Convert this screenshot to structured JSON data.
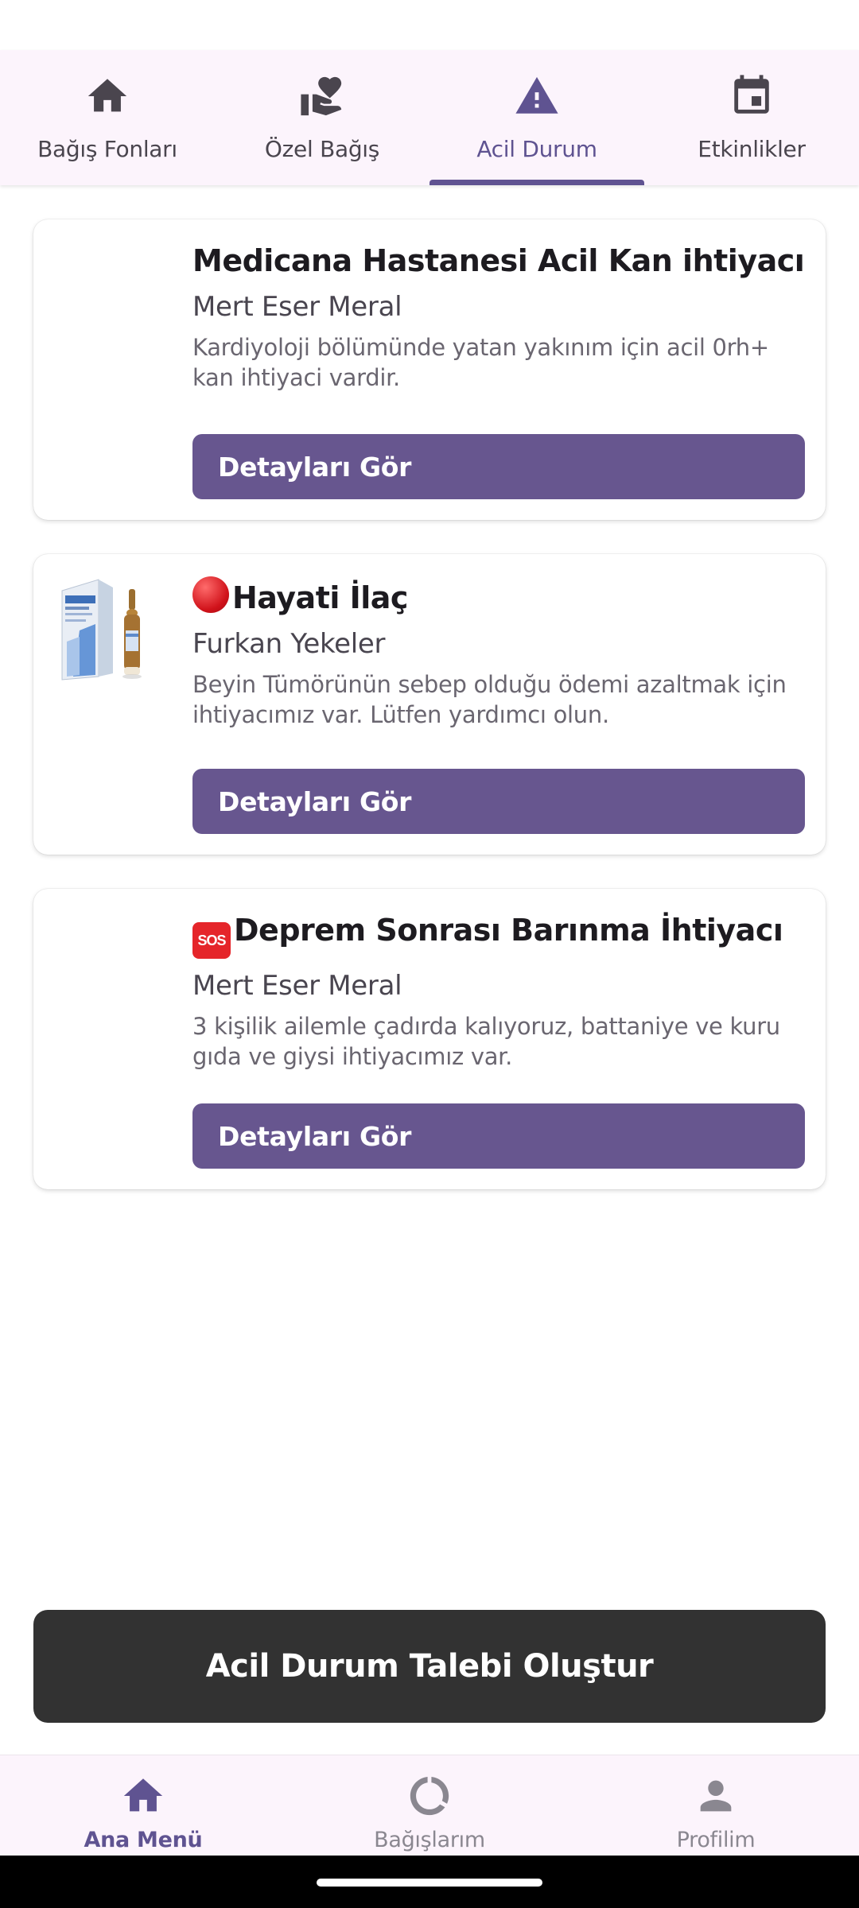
{
  "top_tabs": [
    {
      "label": "Bağış Fonları",
      "icon": "home-icon",
      "active": false
    },
    {
      "label": "Özel Bağış",
      "icon": "volunteer-heart-hand-icon",
      "active": false
    },
    {
      "label": "Acil Durum",
      "icon": "warning-icon",
      "active": true
    },
    {
      "label": "Etkinlikler",
      "icon": "calendar-icon",
      "active": false
    }
  ],
  "cards": [
    {
      "title": "Medicana Hastanesi Acil Kan ihtiyacı",
      "title_emoji": "",
      "author": "Mert Eser Meral",
      "description": "Kardiyoloji bölümünde yatan yakınım için acil 0rh+ kan ihtiyaci vardir.",
      "button_label": "Detayları Gör",
      "has_image": false
    },
    {
      "title": "Hayati İlaç",
      "title_emoji": "red-circle",
      "author": "Furkan Yekeler",
      "description": "Beyin Tümörünün sebep olduğu ödemi azaltmak için ihtiyacımız var. Lütfen yardımcı olun.",
      "button_label": "Detayları Gör",
      "has_image": true
    },
    {
      "title": "Deprem Sonrası Barınma İhtiyacı",
      "title_emoji": "sos",
      "author": "Mert Eser Meral",
      "description": "3 kişilik ailemle çadırda kalıyoruz, battaniye ve kuru gıda ve giysi ihtiyacımız var.",
      "button_label": "Detayları Gör",
      "has_image": false
    }
  ],
  "cta": {
    "label": "Acil Durum Talebi Oluştur"
  },
  "bottom_nav": [
    {
      "label": "Ana Menü",
      "icon": "home-icon",
      "active": true
    },
    {
      "label": "Bağışlarım",
      "icon": "progress-ring-icon",
      "active": false
    },
    {
      "label": "Profilim",
      "icon": "person-icon",
      "active": false
    }
  ],
  "colors": {
    "accent": "#5f5391",
    "button": "#67568f",
    "cta_background": "#323232",
    "nav_background": "#fcf4fc",
    "inactive_icon": "#4a454e",
    "inactive_nav": "#8a8790"
  }
}
